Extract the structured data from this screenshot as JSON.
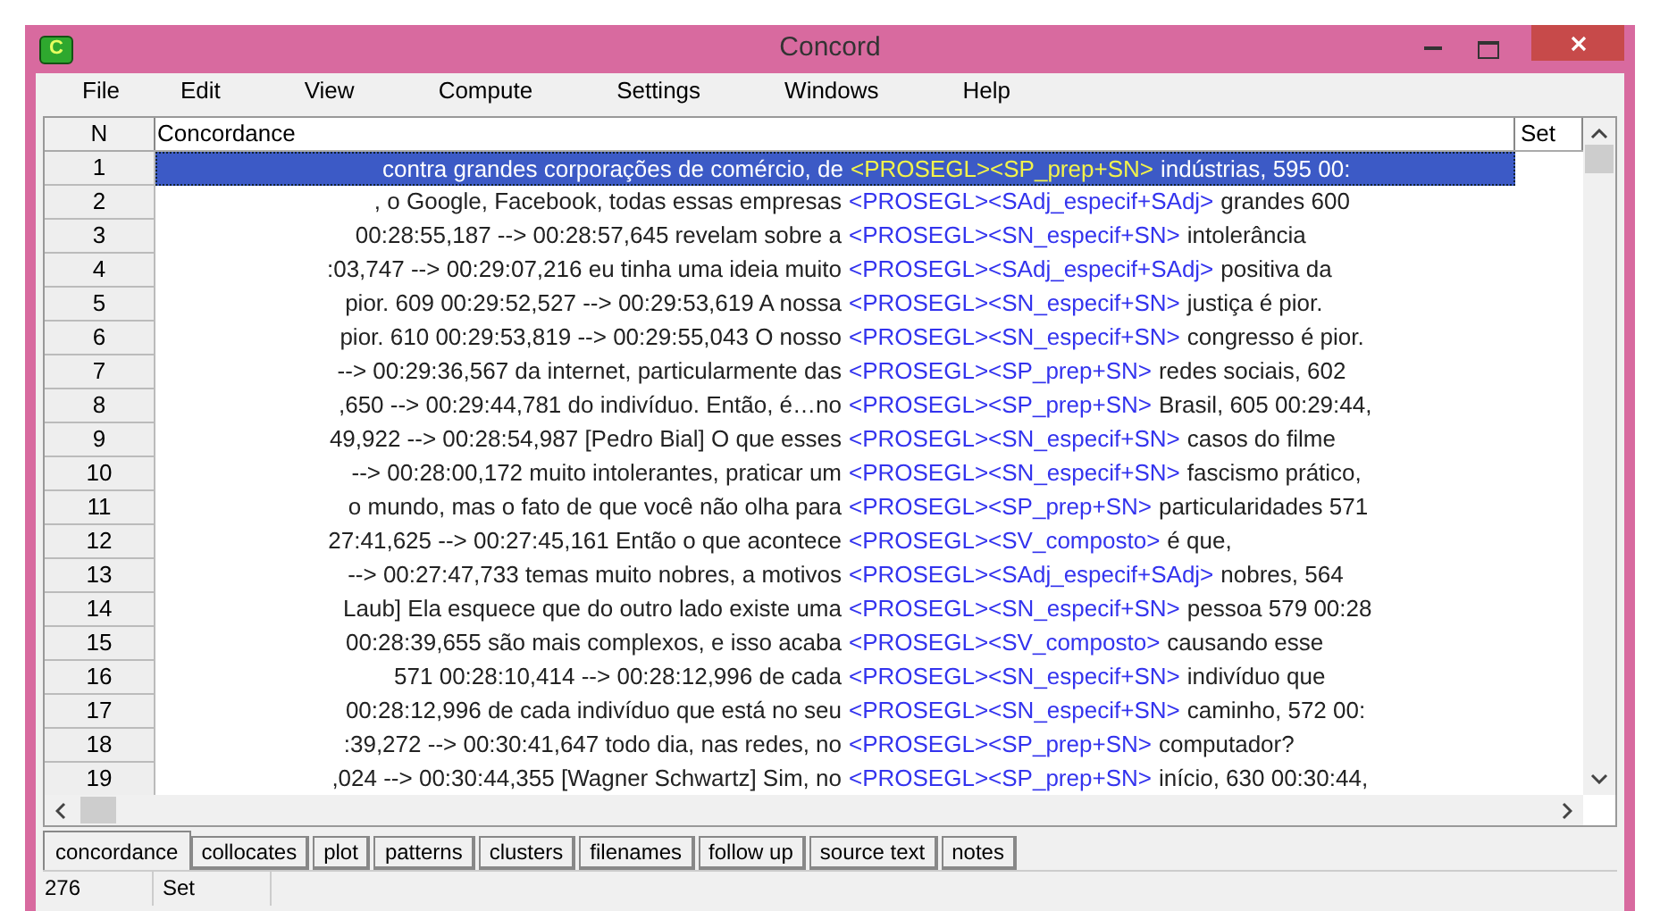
{
  "window": {
    "title": "Concord",
    "app_icon_letter": "C"
  },
  "menu": [
    "File",
    "Edit",
    "View",
    "Compute",
    "Settings",
    "Windows",
    "Help"
  ],
  "table": {
    "columns": [
      "N",
      "Concordance",
      "Set"
    ],
    "rows": [
      {
        "n": "1",
        "left": "contra grandes corporações de comércio, de",
        "tag": "<PROSEGL><SP_prep+SN>",
        "right": "indústrias, 595 00:",
        "selected": true
      },
      {
        "n": "2",
        "left": ", o Google, Facebook, todas essas empresas",
        "tag": "<PROSEGL><SAdj_especif+SAdj>",
        "right": "grandes 600",
        "selected": false
      },
      {
        "n": "3",
        "left": "00:28:55,187 --> 00:28:57,645 revelam sobre a",
        "tag": "<PROSEGL><SN_especif+SN>",
        "right": "intolerância",
        "selected": false
      },
      {
        "n": "4",
        "left": ":03,747 --> 00:29:07,216 eu tinha uma ideia muito",
        "tag": "<PROSEGL><SAdj_especif+SAdj>",
        "right": "positiva da",
        "selected": false
      },
      {
        "n": "5",
        "left": "pior. 609 00:29:52,527 --> 00:29:53,619 A nossa",
        "tag": "<PROSEGL><SN_especif+SN>",
        "right": "justiça é pior.",
        "selected": false
      },
      {
        "n": "6",
        "left": "pior. 610 00:29:53,819 --> 00:29:55,043 O nosso",
        "tag": "<PROSEGL><SN_especif+SN>",
        "right": "congresso é pior.",
        "selected": false
      },
      {
        "n": "7",
        "left": "--> 00:29:36,567 da internet, particularmente das",
        "tag": "<PROSEGL><SP_prep+SN>",
        "right": "redes sociais, 602",
        "selected": false
      },
      {
        "n": "8",
        "left": ",650 --> 00:29:44,781 do indivíduo. Então, é…no",
        "tag": "<PROSEGL><SP_prep+SN>",
        "right": "Brasil, 605 00:29:44,",
        "selected": false
      },
      {
        "n": "9",
        "left": "49,922 --> 00:28:54,987 [Pedro Bial] O que esses",
        "tag": "<PROSEGL><SN_especif+SN>",
        "right": "casos do filme",
        "selected": false
      },
      {
        "n": "10",
        "left": "--> 00:28:00,172 muito intolerantes, praticar um",
        "tag": "<PROSEGL><SN_especif+SN>",
        "right": "fascismo prático,",
        "selected": false
      },
      {
        "n": "11",
        "left": "o mundo, mas o fato de que você não olha para",
        "tag": "<PROSEGL><SP_prep+SN>",
        "right": "particularidades 571",
        "selected": false
      },
      {
        "n": "12",
        "left": "27:41,625 --> 00:27:45,161 Então o que acontece",
        "tag": "<PROSEGL><SV_composto>",
        "right": "é que,",
        "selected": false
      },
      {
        "n": "13",
        "left": "--> 00:27:47,733 temas muito nobres, a motivos",
        "tag": "<PROSEGL><SAdj_especif+SAdj>",
        "right": "nobres, 564",
        "selected": false
      },
      {
        "n": "14",
        "left": "Laub] Ela esquece que do outro lado existe uma",
        "tag": "<PROSEGL><SN_especif+SN>",
        "right": "pessoa 579 00:28",
        "selected": false
      },
      {
        "n": "15",
        "left": "00:28:39,655 são mais complexos, e isso acaba",
        "tag": "<PROSEGL><SV_composto>",
        "right": "causando esse",
        "selected": false
      },
      {
        "n": "16",
        "left": "571 00:28:10,414 --> 00:28:12,996 de cada",
        "tag": "<PROSEGL><SN_especif+SN>",
        "right": "indivíduo que",
        "selected": false
      },
      {
        "n": "17",
        "left": "00:28:12,996 de cada indivíduo que está no seu",
        "tag": "<PROSEGL><SN_especif+SN>",
        "right": "caminho, 572 00:",
        "selected": false
      },
      {
        "n": "18",
        "left": ":39,272 --> 00:30:41,647 todo dia, nas redes, no",
        "tag": "<PROSEGL><SP_prep+SN>",
        "right": "computador?",
        "selected": false
      },
      {
        "n": "19",
        "left": ",024 --> 00:30:44,355 [Wagner Schwartz] Sim, no",
        "tag": "<PROSEGL><SP_prep+SN>",
        "right": "início, 630 00:30:44,",
        "selected": false
      }
    ]
  },
  "tabs": [
    {
      "label": "concordance",
      "selected": true
    },
    {
      "label": "collocates",
      "selected": false
    },
    {
      "label": "plot",
      "selected": false
    },
    {
      "label": "patterns",
      "selected": false
    },
    {
      "label": "clusters",
      "selected": false
    },
    {
      "label": "filenames",
      "selected": false
    },
    {
      "label": "follow up",
      "selected": false
    },
    {
      "label": "source text",
      "selected": false
    },
    {
      "label": "notes",
      "selected": false
    }
  ],
  "status_bar": [
    "276",
    "Set"
  ]
}
